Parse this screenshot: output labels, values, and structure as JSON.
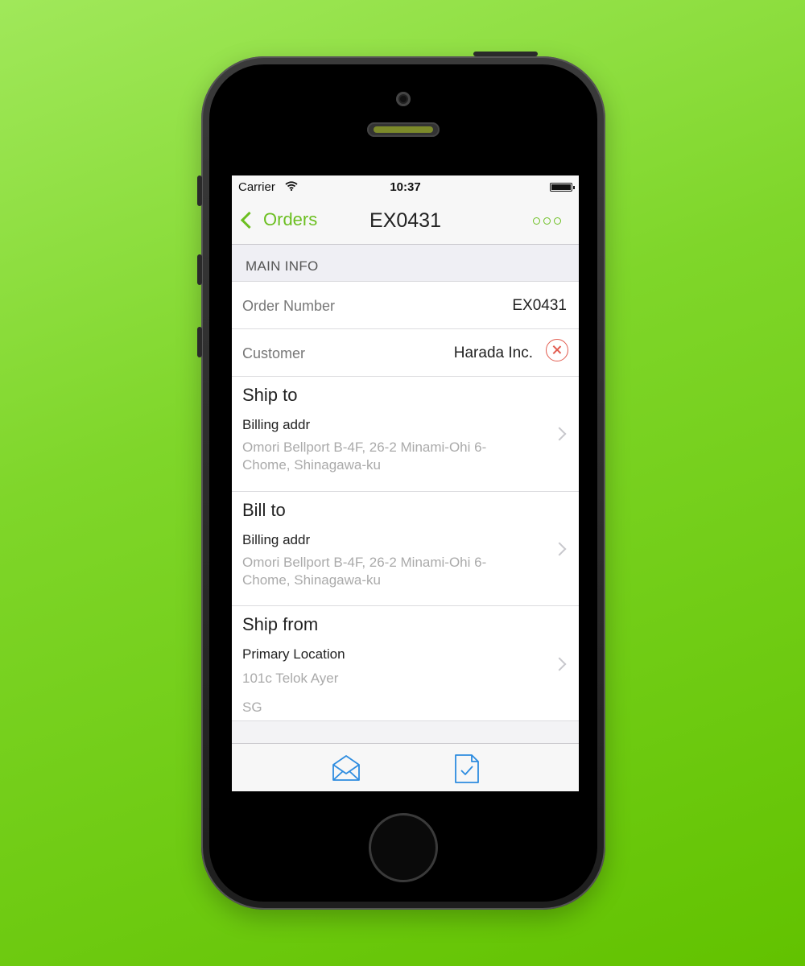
{
  "status_bar": {
    "carrier": "Carrier",
    "time": "10:37"
  },
  "nav": {
    "back_label": "Orders",
    "title": "EX0431"
  },
  "section": {
    "header": "MAIN INFO"
  },
  "fields": {
    "order_number": {
      "label": "Order Number",
      "value": "EX0431"
    },
    "customer": {
      "label": "Customer",
      "value": "Harada Inc."
    }
  },
  "ship_to": {
    "title": "Ship to",
    "name": "Billing addr",
    "address": "Omori Bellport B-4F, 26-2 Minami-Ohi 6-Chome, Shinagawa-ku"
  },
  "bill_to": {
    "title": "Bill to",
    "name": "Billing addr",
    "address": "Omori Bellport B-4F, 26-2 Minami-Ohi 6-Chome, Shinagawa-ku"
  },
  "ship_from": {
    "title": "Ship from",
    "name": "Primary Location",
    "address": "101c Telok Ayer",
    "country": "SG"
  },
  "colors": {
    "accent": "#6cbf21",
    "danger": "#e25b4e",
    "tab_icon": "#2d8ce0",
    "background": "#7fd62a"
  },
  "icons": {
    "back": "chevron-left-icon",
    "more": "more-dots-icon",
    "clear": "clear-circle-icon",
    "mail": "envelope-open-icon",
    "doc": "document-check-icon",
    "disclosure": "chevron-right-icon"
  }
}
